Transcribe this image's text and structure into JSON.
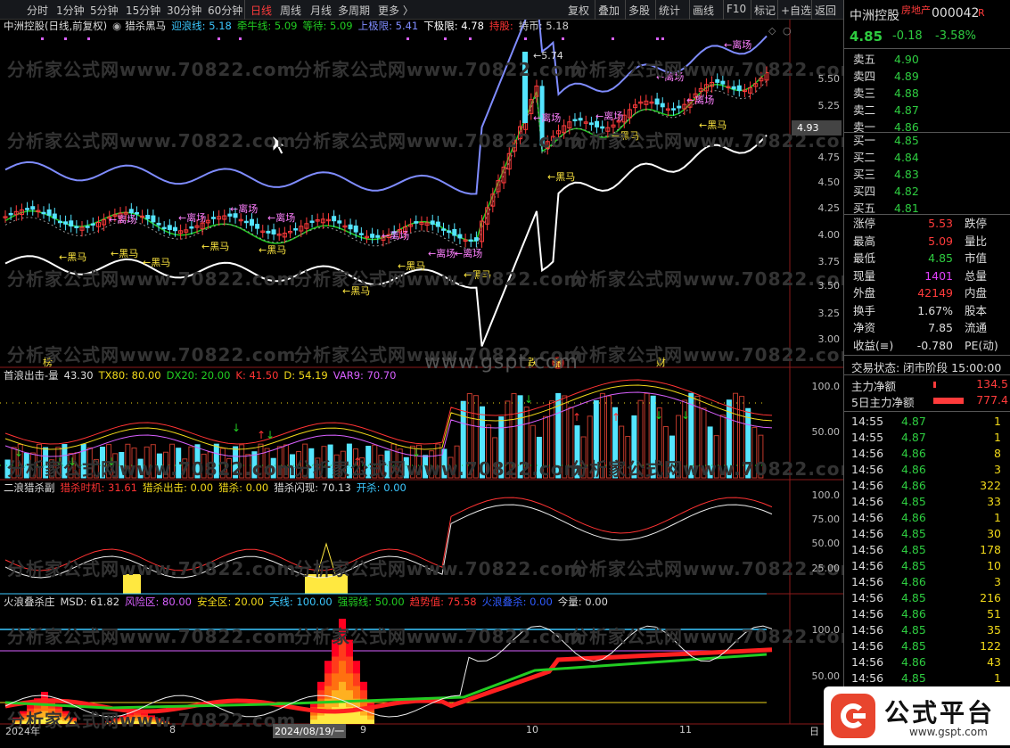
{
  "topbar": {
    "periods": [
      "分时",
      "1分钟",
      "5分钟",
      "15分钟",
      "30分钟",
      "60分钟",
      "日线",
      "周线",
      "月线",
      "多周期",
      "更多 〉"
    ],
    "active_period": "日线",
    "tools": [
      "复权",
      "叠加",
      "多股",
      "统计",
      "画线",
      "F10",
      "标记",
      "+自选",
      "返回"
    ]
  },
  "main_panel": {
    "title": "中洲控股(日线,前复权)",
    "indicator_name": "猎杀黑马",
    "params": [
      {
        "label": "迎浪线: 5.18",
        "color": "#3cc8ff"
      },
      {
        "label": "牵牛线: 5.09",
        "color": "#22cc22"
      },
      {
        "label": "等待: 5.09",
        "color": "#22cc22"
      },
      {
        "label": "上极限: 5.41",
        "color": "#7f8cff"
      },
      {
        "label": "下极限: 4.78",
        "color": "#ffffff"
      },
      {
        "label": "持股:",
        "color": "#ff3333"
      },
      {
        "label": "持币: 5.18",
        "color": "#cccccc"
      }
    ],
    "y_ticks": [
      "5.50",
      "5.25",
      "5.00",
      "4.75",
      "4.50",
      "4.25",
      "4.00",
      "3.75",
      "3.50",
      "3.25",
      "3.00"
    ],
    "price_tag": "4.93",
    "high_label": "5.74",
    "annotations": {
      "lichang": "←离场",
      "heima": "←黑马",
      "bang": "榜",
      "die": "跌",
      "zhang": "涨",
      "cai": "财"
    }
  },
  "panel2": {
    "title": "首浪出击-量",
    "params": [
      {
        "label": "43.30",
        "color": "#dddddd"
      },
      {
        "label": "TX80: 80.00",
        "color": "#f1d91a"
      },
      {
        "label": "DX20: 20.00",
        "color": "#22cc22"
      },
      {
        "label": "K: 41.50",
        "color": "#ff3333"
      },
      {
        "label": "D: 54.19",
        "color": "#f1d91a"
      },
      {
        "label": "VAR9: 70.70",
        "color": "#d860ff"
      }
    ],
    "y_ticks": [
      "100.0",
      "50.00"
    ]
  },
  "panel3": {
    "title": "二浪猎杀副",
    "params": [
      {
        "label": "猎杀时机: 31.61",
        "color": "#ff3333"
      },
      {
        "label": "猎杀出击: 0.00",
        "color": "#f1d91a"
      },
      {
        "label": "猎杀: 0.00",
        "color": "#f1d91a"
      },
      {
        "label": "猎杀闪现: 70.13",
        "color": "#dddddd"
      },
      {
        "label": "开杀: 0.00",
        "color": "#3cc8ff"
      }
    ],
    "y_ticks": [
      "100.0",
      "75.00",
      "50.00",
      "25.00"
    ]
  },
  "panel4": {
    "title": "火浪叠杀庄",
    "params": [
      {
        "label": "MSD: 61.82",
        "color": "#dddddd"
      },
      {
        "label": "风险区: 80.00",
        "color": "#d860ff"
      },
      {
        "label": "安全区: 20.00",
        "color": "#f1d91a"
      },
      {
        "label": "天线: 100.00",
        "color": "#3cc8ff"
      },
      {
        "label": "强弱线: 50.00",
        "color": "#22cc22"
      },
      {
        "label": "趋势值: 75.58",
        "color": "#ff3333"
      },
      {
        "label": "火浪叠杀: 0.00",
        "color": "#2f5bff"
      },
      {
        "label": "今量: 0.00",
        "color": "#dddddd"
      }
    ],
    "y_ticks": [
      "100.0",
      "50.00"
    ]
  },
  "x_axis": {
    "labels": [
      "2024年",
      "8",
      "2024/08/19/一",
      "9",
      "10",
      "11"
    ],
    "right_label": "日"
  },
  "watermarks": [
    "分析家公式网www.70822.com",
    "www.gsjt.com",
    "www.gspt.com"
  ],
  "quote": {
    "name": "中洲控股",
    "sector": "房地产",
    "code": "000042",
    "flag": "R",
    "price": "4.85",
    "change": "-0.18",
    "pct": "-3.58%",
    "asks": [
      {
        "label": "卖五",
        "price": "4.90"
      },
      {
        "label": "卖四",
        "price": "4.89"
      },
      {
        "label": "卖三",
        "price": "4.88"
      },
      {
        "label": "卖二",
        "price": "4.87"
      },
      {
        "label": "卖一",
        "price": "4.86"
      }
    ],
    "bids": [
      {
        "label": "买一",
        "price": "4.85"
      },
      {
        "label": "买二",
        "price": "4.84"
      },
      {
        "label": "买三",
        "price": "4.83"
      },
      {
        "label": "买四",
        "price": "4.82"
      },
      {
        "label": "买五",
        "price": "4.81"
      }
    ],
    "stats": [
      {
        "l": "涨停",
        "v": "5.53",
        "vc": "#ff3b3b",
        "l2": "跌停"
      },
      {
        "l": "最高",
        "v": "5.09",
        "vc": "#ff3b3b",
        "l2": "量比"
      },
      {
        "l": "最低",
        "v": "4.85",
        "vc": "#2ecc40",
        "l2": "市值"
      },
      {
        "l": "现量",
        "v": "1401",
        "vc": "#e040fb",
        "l2": "总量"
      },
      {
        "l": "外盘",
        "v": "42149",
        "vc": "#ff3b3b",
        "l2": "内盘"
      },
      {
        "l": "换手",
        "v": "1.67%",
        "vc": "#dddddd",
        "l2": "股本"
      },
      {
        "l": "净资",
        "v": "7.85",
        "vc": "#dddddd",
        "l2": "流通"
      },
      {
        "l": "收益(≡)",
        "v": "-0.780",
        "vc": "#dddddd",
        "l2": "PE(动)"
      }
    ],
    "trade_status": "交易状态: 闭市阶段 15:00:00",
    "main_flow": {
      "label": "主力净额",
      "value": "134.5"
    },
    "main_flow5": {
      "label": "5日主力净额",
      "value": "777.4"
    },
    "ticks": [
      {
        "t": "14:55",
        "p": "4.87",
        "v": "1"
      },
      {
        "t": "14:55",
        "p": "4.87",
        "v": "1"
      },
      {
        "t": "14:56",
        "p": "4.86",
        "v": "8"
      },
      {
        "t": "14:56",
        "p": "4.86",
        "v": "3"
      },
      {
        "t": "14:56",
        "p": "4.86",
        "v": "322"
      },
      {
        "t": "14:56",
        "p": "4.85",
        "v": "33"
      },
      {
        "t": "14:56",
        "p": "4.86",
        "v": "1"
      },
      {
        "t": "14:56",
        "p": "4.85",
        "v": "30"
      },
      {
        "t": "14:56",
        "p": "4.85",
        "v": "178"
      },
      {
        "t": "14:56",
        "p": "4.85",
        "v": "10"
      },
      {
        "t": "14:56",
        "p": "4.86",
        "v": "3"
      },
      {
        "t": "14:56",
        "p": "4.85",
        "v": "216"
      },
      {
        "t": "14:56",
        "p": "4.86",
        "v": "51"
      },
      {
        "t": "14:56",
        "p": "4.85",
        "v": "35"
      },
      {
        "t": "14:56",
        "p": "4.85",
        "v": "122"
      },
      {
        "t": "14:56",
        "p": "4.86",
        "v": "43"
      },
      {
        "t": "14:56",
        "p": "4.85",
        "v": "1"
      }
    ]
  },
  "logo": {
    "text": "公式平台",
    "url": "www.gspt.com"
  }
}
